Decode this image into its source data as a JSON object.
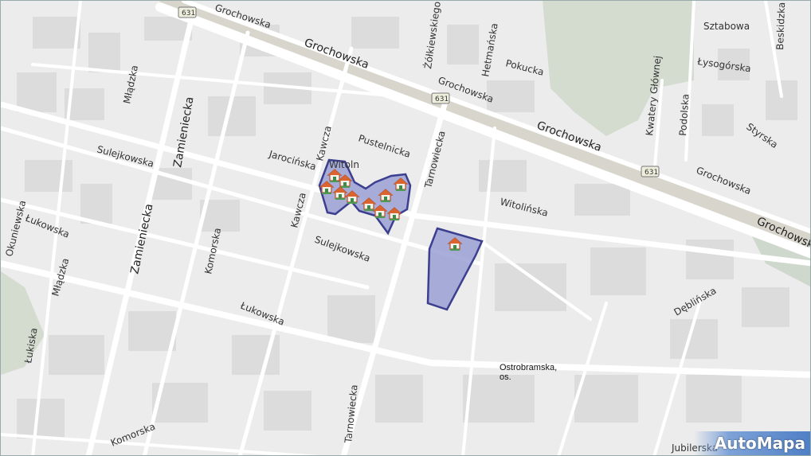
{
  "map": {
    "streets": [
      {
        "id": "grochowska-top",
        "text": "Grochowska"
      },
      {
        "id": "grochowska-main",
        "text": "Grochowska"
      },
      {
        "id": "grochowska-mid",
        "text": "Grochowska"
      },
      {
        "id": "grochowska-big2",
        "text": "Grochowska"
      },
      {
        "id": "grochowska-right",
        "text": "Grochowska"
      },
      {
        "id": "grochowska-far",
        "text": "Grochowska"
      },
      {
        "id": "zolkiewskiego",
        "text": "Żółkiewskiego"
      },
      {
        "id": "hetmanska",
        "text": "Hetmańska"
      },
      {
        "id": "pokucka",
        "text": "Pokucka"
      },
      {
        "id": "sztabowa",
        "text": "Sztabowa"
      },
      {
        "id": "beskidzka",
        "text": "Beskidzka"
      },
      {
        "id": "lysogorska",
        "text": "Łysogórska"
      },
      {
        "id": "kwatery",
        "text": "Kwatery Głównej"
      },
      {
        "id": "podolska",
        "text": "Podolska"
      },
      {
        "id": "styrska",
        "text": "Styrska"
      },
      {
        "id": "mladzka1",
        "text": "Młądzka"
      },
      {
        "id": "zamieniecka1",
        "text": "Zamieniecka"
      },
      {
        "id": "zamieniecka2",
        "text": "Zamieniecka"
      },
      {
        "id": "sulejkowska1",
        "text": "Sulejkowska"
      },
      {
        "id": "sulejkowska2",
        "text": "Sulejkowska"
      },
      {
        "id": "kawcza1",
        "text": "Kawcza"
      },
      {
        "id": "kawcza2",
        "text": "Kawcza"
      },
      {
        "id": "jarocinska",
        "text": "Jarocińska"
      },
      {
        "id": "pustelnicka",
        "text": "Pustelnicka"
      },
      {
        "id": "tarnowiecka1",
        "text": "Tarnowiecka"
      },
      {
        "id": "tarnowiecka2",
        "text": "Tarnowiecka"
      },
      {
        "id": "witolinska",
        "text": "Witolińska"
      },
      {
        "id": "okuniewska",
        "text": "Okuniewska"
      },
      {
        "id": "lukowska1",
        "text": "Łukowska"
      },
      {
        "id": "lukowska2",
        "text": "Łukowska"
      },
      {
        "id": "mladzka2",
        "text": "Młądzka"
      },
      {
        "id": "komorska1",
        "text": "Komorska"
      },
      {
        "id": "komorska2",
        "text": "Komorska"
      },
      {
        "id": "lukiska",
        "text": "Łukiska"
      },
      {
        "id": "deblinska",
        "text": "Dęblińska"
      },
      {
        "id": "jubilerska",
        "text": "Jubilerska"
      }
    ],
    "route_badges": [
      {
        "id": "r1",
        "text": "631"
      },
      {
        "id": "r2",
        "text": "631"
      },
      {
        "id": "r3",
        "text": "631"
      }
    ],
    "partial_label": "Witoln",
    "poi": {
      "line1": "Ostrobramska,",
      "line2": "os."
    },
    "colors": {
      "area_fill": "#9aa0d4",
      "area_stroke": "#3c3f8f",
      "road": "#ffffff",
      "block": "#dcdcdc",
      "green": "#d6ddd2"
    },
    "icon_name": "house-icon",
    "logo": "AutoMapa"
  }
}
